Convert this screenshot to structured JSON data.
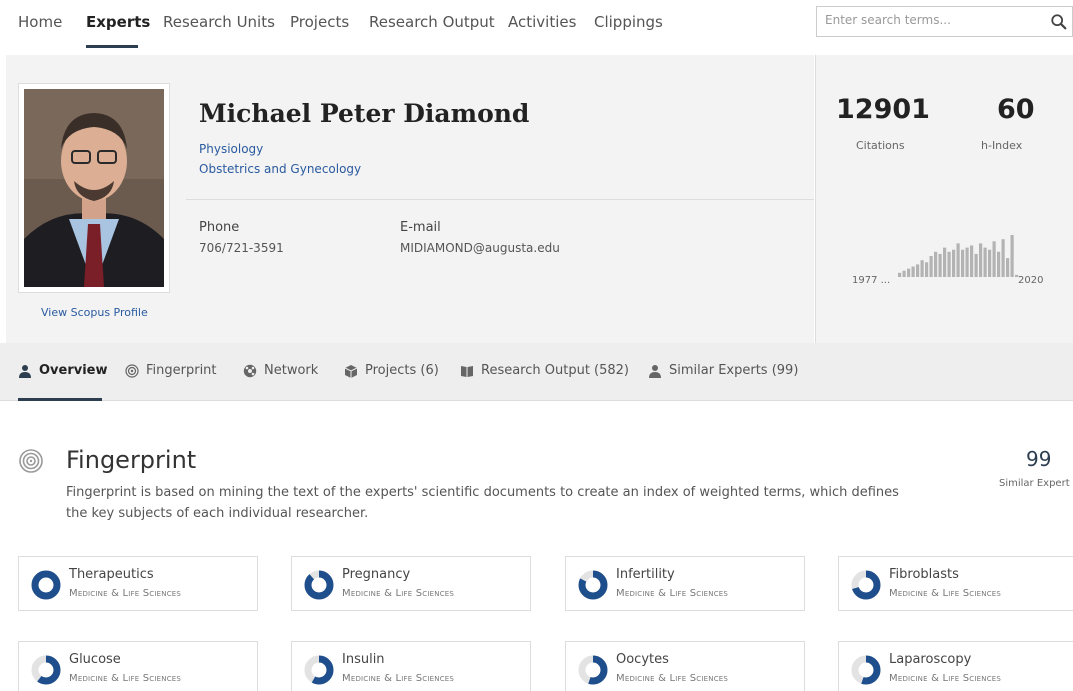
{
  "nav": {
    "items": [
      "Home",
      "Experts",
      "Research Units",
      "Projects",
      "Research Output",
      "Activities",
      "Clippings"
    ],
    "active": "Experts",
    "search_placeholder": "Enter search terms..."
  },
  "profile": {
    "name": "Michael Peter Diamond",
    "departments": [
      "Physiology",
      "Obstetrics and Gynecology"
    ],
    "phone_label": "Phone",
    "phone": "706/721-3591",
    "email_label": "E-mail",
    "email": "MIDIAMOND@augusta.edu",
    "scopus_link": "View Scopus Profile"
  },
  "metrics": {
    "citations_value": "12901",
    "citations_label": "Citations",
    "hindex_value": "60",
    "hindex_label": "h-Index",
    "chart_start": "1977 ...",
    "chart_end": "2020"
  },
  "chart_data": {
    "type": "bar",
    "x": [
      "1977 ...",
      "2020"
    ],
    "values": [
      2,
      3,
      4,
      5,
      6,
      8,
      7,
      10,
      12,
      11,
      14,
      12,
      13,
      16,
      13,
      14,
      15,
      11,
      16,
      14,
      13,
      17,
      12,
      18,
      9,
      20,
      1
    ],
    "color": "#b3b3b3"
  },
  "tabs": [
    {
      "label": "Overview",
      "icon": "person-icon",
      "active": true
    },
    {
      "label": "Fingerprint",
      "icon": "fingerprint-icon",
      "active": false
    },
    {
      "label": "Network",
      "icon": "network-icon",
      "active": false
    },
    {
      "label": "Projects (6)",
      "icon": "box-icon",
      "active": false
    },
    {
      "label": "Research Output (582)",
      "icon": "book-icon",
      "active": false
    },
    {
      "label": "Similar Experts (99)",
      "icon": "person-icon",
      "active": false
    }
  ],
  "fingerprint": {
    "title": "Fingerprint",
    "description": "Fingerprint is based on mining the text of the experts' scientific documents to create an index of weighted terms, which defines the key subjects of each individual researcher.",
    "similar_count": "99",
    "similar_label": "Similar Expert",
    "terms": [
      {
        "term": "Therapeutics",
        "category": "Medicine & Life Sciences",
        "weight": 1.0
      },
      {
        "term": "Pregnancy",
        "category": "Medicine & Life Sciences",
        "weight": 0.88
      },
      {
        "term": "Infertility",
        "category": "Medicine & Life Sciences",
        "weight": 0.82
      },
      {
        "term": "Fibroblasts",
        "category": "Medicine & Life Sciences",
        "weight": 0.7
      },
      {
        "term": "Glucose",
        "category": "Medicine & Life Sciences",
        "weight": 0.6
      },
      {
        "term": "Insulin",
        "category": "Medicine & Life Sciences",
        "weight": 0.58
      },
      {
        "term": "Oocytes",
        "category": "Medicine & Life Sciences",
        "weight": 0.55
      },
      {
        "term": "Laparoscopy",
        "category": "Medicine & Life Sciences",
        "weight": 0.55
      }
    ]
  },
  "colors": {
    "accent": "#2a5aa0",
    "donut": "#1f4e8c",
    "donut_track": "#e3e3e3"
  }
}
